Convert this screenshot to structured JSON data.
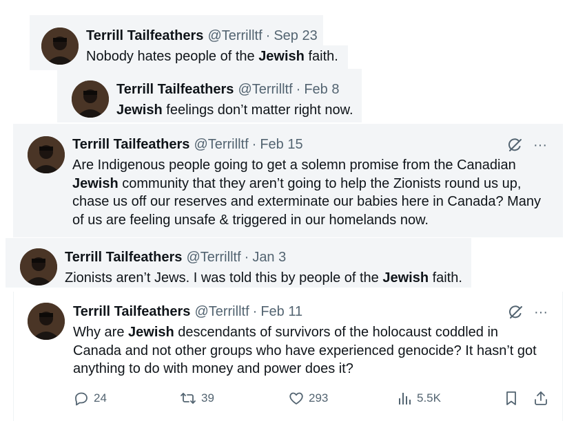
{
  "tweets": [
    {
      "name": "Terrill Tailfeathers",
      "handle": "@Terrilltf",
      "sep": "·",
      "date": "Sep 23",
      "parts": [
        "Nobody hates people of the ",
        "Jewish",
        " faith."
      ]
    },
    {
      "name": "Terrill Tailfeathers",
      "handle": "@Terrilltf",
      "sep": "·",
      "date": "Feb 8",
      "parts": [
        "Jewish",
        " feelings don’t matter right now."
      ]
    },
    {
      "name": "Terrill Tailfeathers",
      "handle": "@Terrilltf",
      "sep": "·",
      "date": "Feb 15",
      "line1": "Are Indigenous people going to get a solemn promise from the Canadian",
      "line2_bold": "Jewish",
      "line2_rest": " community that they aren’t going to help the Zionists round us up,",
      "line3": "chase us off our reserves and exterminate our babies here in Canada? Many",
      "line4": "of us are feeling unsafe & triggered in our homelands now.",
      "more": "···"
    },
    {
      "name": "Terrill Tailfeathers",
      "handle": "@Terrilltf",
      "sep": "·",
      "date": "Jan 3",
      "parts": [
        "Zionists aren’t Jews. I was told this by people of the ",
        "Jewish",
        " faith."
      ]
    },
    {
      "name": "Terrill Tailfeathers",
      "handle": "@Terrilltf",
      "sep": "·",
      "date": "Feb 11",
      "line1_pre": "Why are ",
      "line1_bold": "Jewish",
      "line1_rest": " descendants of survivors of the holocaust coddled in",
      "line2": "Canada and not other groups who have experienced genocide? It hasn’t got",
      "line3": "anything to do with money and power does it?",
      "more": "···"
    }
  ],
  "actions": {
    "replies": "24",
    "reposts": "39",
    "likes": "293",
    "views": "5.5K"
  },
  "icons": {
    "grok": "grok-icon",
    "more": "more-icon",
    "reply": "reply-icon",
    "repost": "repost-icon",
    "like": "like-icon",
    "views": "views-icon",
    "bookmark": "bookmark-icon",
    "share": "share-icon"
  },
  "colors": {
    "text": "#0f1419",
    "secondary": "#536471",
    "card": "#f3f5f7"
  }
}
